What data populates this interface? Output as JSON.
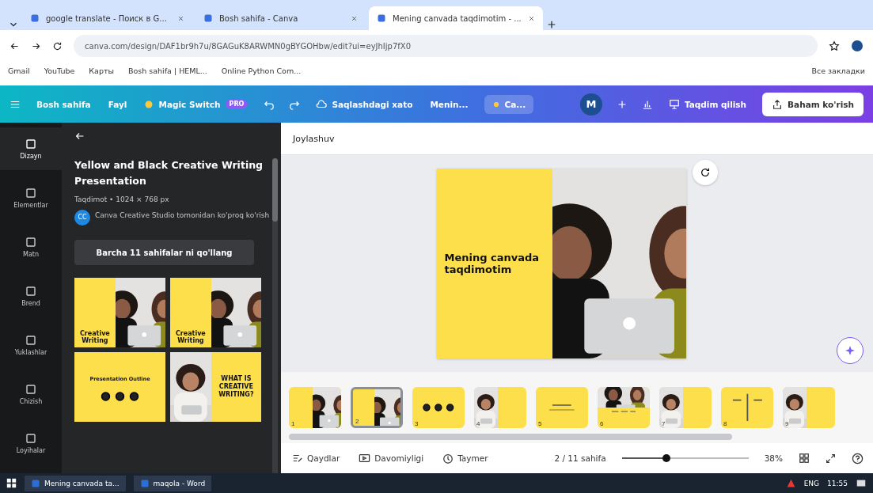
{
  "browser": {
    "tabs": [
      {
        "title": "google translate - Поиск в G...",
        "selected": false
      },
      {
        "title": "Bosh sahifa - Canva",
        "selected": false
      },
      {
        "title": "Mening canvada taqdimotim - ...",
        "selected": true
      }
    ],
    "address": "canva.com/design/DAF1br9h7u/8GAGuK8ARWMN0gBYGOHbw/edit?ui=eyJhIjp7fX0",
    "bookmarks": [
      "Gmail",
      "YouTube",
      "Карты",
      "Bosh sahifa | HEML...",
      "Online Python Com..."
    ],
    "all_bookmarks": "Все закладки"
  },
  "toolbar": {
    "home": "Bosh sahifa",
    "file": "Fayl",
    "magic": "Magic Switch",
    "magic_badge": "PRO",
    "save_status": "Saqlashdagi xato",
    "title": "Menin...",
    "chip": "Ca...",
    "avatar": "M",
    "present": "Taqdim qilish",
    "share": "Baham ko'rish"
  },
  "rail": [
    {
      "label": "Dizayn",
      "selected": true
    },
    {
      "label": "Elementlar",
      "selected": false
    },
    {
      "label": "Matn",
      "selected": false
    },
    {
      "label": "Brend",
      "selected": false
    },
    {
      "label": "Yuklashlar",
      "selected": false
    },
    {
      "label": "Chizish",
      "selected": false
    },
    {
      "label": "Loyihalar",
      "selected": false
    }
  ],
  "panel": {
    "title": "Yellow and Black Creative Writing Presentation",
    "meta": "Taqdimot • 1024 × 768 px",
    "author_avatar": "CC",
    "author": "Canva Creative Studio tomonidan ko'proq ko'rish",
    "apply": "Barcha 11 sahifalar ni qo'llang",
    "templates": [
      {
        "heading": "Creative Writing"
      },
      {
        "heading": "Creative Writing"
      },
      {
        "kind": "outline",
        "heading": "Presentation Outline"
      },
      {
        "kind": "portrait",
        "heading": "WHAT IS CREATIVE WRITING?"
      }
    ]
  },
  "editor": {
    "section": "Joylashuv",
    "slide_title": "Mening canvada taqdimotim"
  },
  "pages": [
    {
      "number": "1",
      "selected": false
    },
    {
      "number": "2",
      "selected": true
    },
    {
      "number": "3",
      "kind": "outline",
      "selected": false
    },
    {
      "number": "4",
      "kind": "portrait",
      "selected": false
    },
    {
      "number": "5",
      "kind": "text",
      "selected": false
    },
    {
      "number": "6",
      "kind": "banner",
      "selected": false
    },
    {
      "number": "7",
      "kind": "portrait",
      "selected": false
    },
    {
      "number": "8",
      "kind": "columns",
      "selected": false
    },
    {
      "number": "9",
      "kind": "portrait",
      "selected": false
    }
  ],
  "footer": {
    "notes": "Qaydlar",
    "duration": "Davomiyligi",
    "timer": "Taymer",
    "page_count": "2 / 11 sahifa",
    "zoom": {
      "level": 0.35
    },
    "zoom_reading": "38%"
  },
  "taskbar": {
    "apps": [
      "Mening canvada ta...",
      "maqola - Word"
    ],
    "lang": "ENG",
    "time": "11:55"
  }
}
